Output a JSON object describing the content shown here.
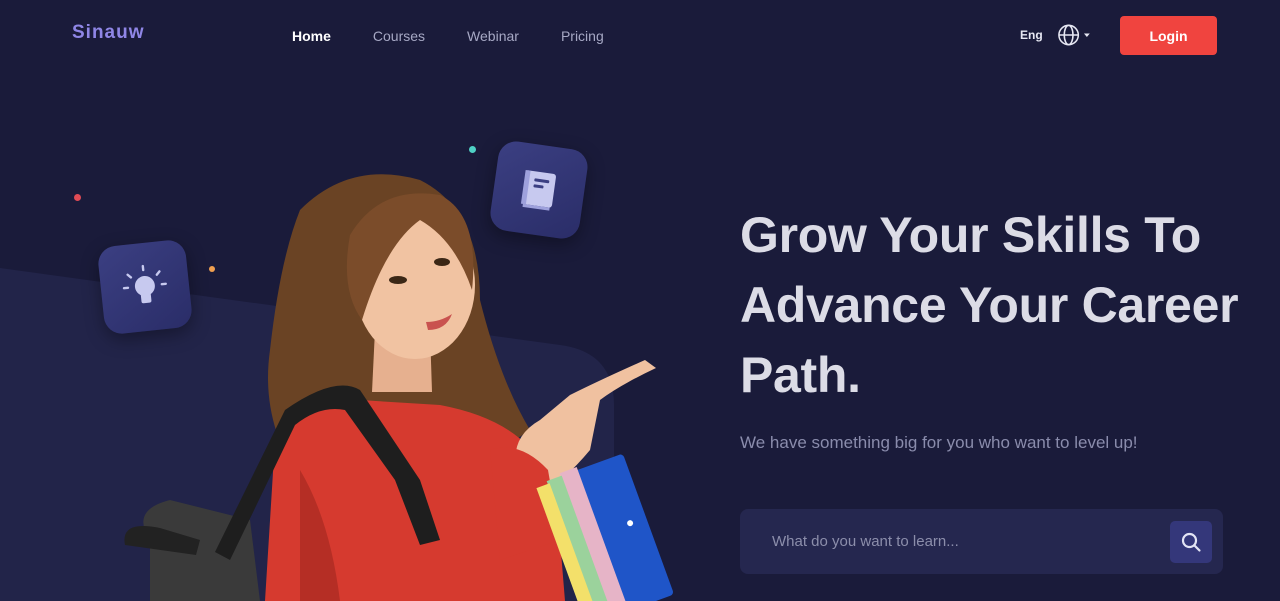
{
  "brand": {
    "logo": "Sinauw"
  },
  "nav": {
    "items": [
      {
        "label": "Home",
        "active": true
      },
      {
        "label": "Courses",
        "active": false
      },
      {
        "label": "Webinar",
        "active": false
      },
      {
        "label": "Pricing",
        "active": false
      }
    ]
  },
  "header": {
    "language": "Eng",
    "language_icon": "globe-icon",
    "login_label": "Login"
  },
  "hero": {
    "headline": "Grow Your Skills To Advance Your Career Path.",
    "subtitle": "We have something big for you who want to level up!",
    "search": {
      "placeholder": "What do you want to learn...",
      "value": "",
      "button_icon": "search-icon"
    },
    "tiles": [
      {
        "icon": "lightbulb-icon"
      },
      {
        "icon": "book-icon"
      }
    ]
  },
  "colors": {
    "background": "#1a1b3a",
    "accent": "#f0443f",
    "logo": "#8f86e6",
    "tile": "#34377a",
    "dot_red": "#e04b55",
    "dot_teal": "#4fd1c5",
    "dot_orange": "#f0a050"
  }
}
